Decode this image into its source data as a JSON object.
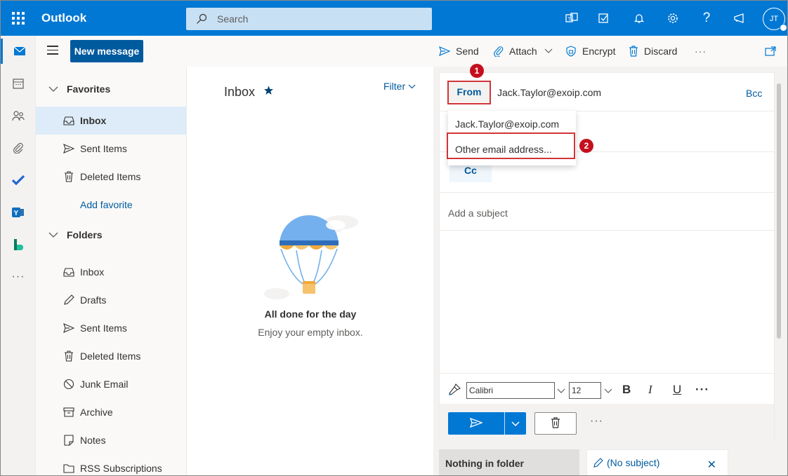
{
  "topbar": {
    "brand": "Outlook",
    "search_placeholder": "Search",
    "avatar_initials": "JT"
  },
  "commandbar": {
    "new_message": "New message",
    "send": "Send",
    "attach": "Attach",
    "encrypt": "Encrypt",
    "discard": "Discard",
    "more": "···"
  },
  "folders": {
    "favorites_header": "Favorites",
    "favorites": [
      {
        "label": "Inbox",
        "icon": "inbox-icon"
      },
      {
        "label": "Sent Items",
        "icon": "send-icon"
      },
      {
        "label": "Deleted Items",
        "icon": "trash-icon"
      }
    ],
    "add_favorite": "Add favorite",
    "folders_header": "Folders",
    "items": [
      {
        "label": "Inbox",
        "icon": "inbox-icon"
      },
      {
        "label": "Drafts",
        "icon": "pencil-icon"
      },
      {
        "label": "Sent Items",
        "icon": "send-icon"
      },
      {
        "label": "Deleted Items",
        "icon": "trash-icon"
      },
      {
        "label": "Junk Email",
        "icon": "block-icon"
      },
      {
        "label": "Archive",
        "icon": "archive-icon"
      },
      {
        "label": "Notes",
        "icon": "note-icon"
      },
      {
        "label": "RSS Subscriptions",
        "icon": "folder-icon"
      }
    ]
  },
  "message_list": {
    "title": "Inbox",
    "filter": "Filter",
    "empty_title": "All done for the day",
    "empty_subtitle": "Enjoy your empty inbox."
  },
  "compose": {
    "from_label": "From",
    "from_address": "Jack.Taylor@exoip.com",
    "bcc": "Bcc",
    "cc": "Cc",
    "dropdown": [
      "Jack.Taylor@exoip.com",
      "Other email address..."
    ],
    "subject_placeholder": "Add a subject",
    "font": "Calibri",
    "font_size": "12",
    "bold": "B",
    "italic": "I",
    "underline": "U",
    "more": "···"
  },
  "annotations": {
    "marker1": "1",
    "marker2": "2",
    "highlight_color": "#d13438"
  },
  "bottom_tabs": {
    "nothing": "Nothing in folder",
    "draft": "(No subject)"
  },
  "colors": {
    "brand_blue": "#0078d4",
    "link_blue": "#005a9e",
    "selected_bg": "#deecf9"
  }
}
